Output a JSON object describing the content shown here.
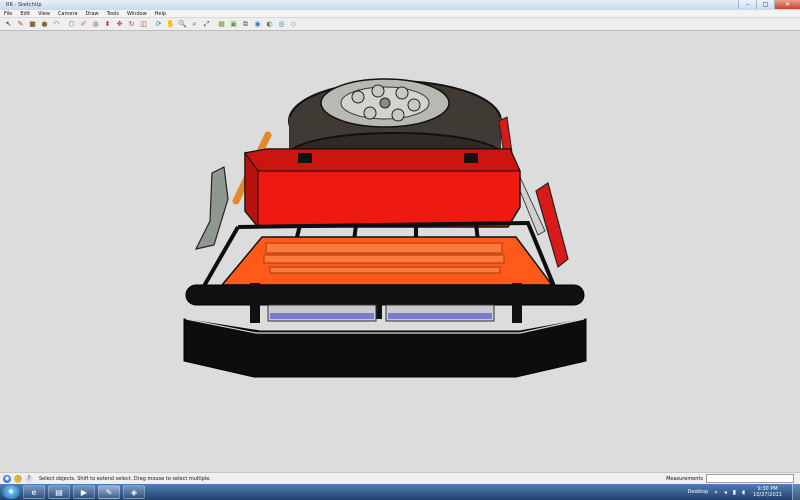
{
  "window": {
    "title": "RR - SketchUp",
    "controls": {
      "minimize": "–",
      "maximize": "□",
      "close": "✕"
    }
  },
  "menu": [
    "File",
    "Edit",
    "View",
    "Camera",
    "Draw",
    "Tools",
    "Window",
    "Help"
  ],
  "toolbar": {
    "tools": [
      {
        "name": "select-tool",
        "glyph": "↖",
        "color": "#222222"
      },
      {
        "name": "pencil-tool",
        "glyph": "✎",
        "color": "#c0392b"
      },
      {
        "name": "rectangle-tool",
        "glyph": "■",
        "color": "#8a6a3b"
      },
      {
        "name": "circle-tool",
        "glyph": "●",
        "color": "#8a6a3b"
      },
      {
        "name": "arc-tool",
        "glyph": "◠",
        "color": "#444444"
      },
      {
        "name": "polygon-tool",
        "glyph": "⬡",
        "color": "#2c7bb6"
      },
      {
        "name": "eraser-tool",
        "glyph": "✐",
        "color": "#d9587a"
      },
      {
        "name": "tape-measure-tool",
        "glyph": "◍",
        "color": "#777777"
      },
      {
        "name": "push-pull-tool",
        "glyph": "⬍",
        "color": "#b03a2e"
      },
      {
        "name": "move-tool",
        "glyph": "✥",
        "color": "#c0392b"
      },
      {
        "name": "rotate-tool",
        "glyph": "↻",
        "color": "#c0392b"
      },
      {
        "name": "offset-tool",
        "glyph": "◫",
        "color": "#b03a2e"
      },
      {
        "name": "orbit-tool",
        "glyph": "⟳",
        "color": "#2c7bb6"
      },
      {
        "name": "pan-tool",
        "glyph": "✋",
        "color": "#444444"
      },
      {
        "name": "zoom-tool",
        "glyph": "🔍",
        "color": "#444444"
      },
      {
        "name": "zoom-window-tool",
        "glyph": "⌕",
        "color": "#444444"
      },
      {
        "name": "zoom-extents-tool",
        "glyph": "⤢",
        "color": "#444444"
      },
      {
        "name": "get-models-tool",
        "glyph": "▦",
        "color": "#6a9a3a"
      },
      {
        "name": "share-model-tool",
        "glyph": "▣",
        "color": "#6a9a3a"
      },
      {
        "name": "components-tool",
        "glyph": "⧉",
        "color": "#555555"
      },
      {
        "name": "google-earth-tool",
        "glyph": "◉",
        "color": "#2c7bb6"
      },
      {
        "name": "place-model-tool",
        "glyph": "◐",
        "color": "#3a8a3a"
      },
      {
        "name": "geo-location-tool",
        "glyph": "◎",
        "color": "#2c7bb6"
      },
      {
        "name": "styles-tool",
        "glyph": "◇",
        "color": "#888888"
      }
    ]
  },
  "status": {
    "hint": "Select objects. Shift to extend select. Drag mouse to select multiple.",
    "measurements_label": "Measurements",
    "measurements_value": ""
  },
  "taskbar": {
    "start_glyph": "❖",
    "apps": [
      {
        "name": "internet-explorer-task",
        "glyph": "e"
      },
      {
        "name": "file-explorer-task",
        "glyph": "▤"
      },
      {
        "name": "media-player-task",
        "glyph": "▶"
      },
      {
        "name": "sketchup-task",
        "glyph": "✎"
      },
      {
        "name": "other-task",
        "glyph": "◈"
      }
    ],
    "tray_label": "Desktop",
    "tray_icons": "» ◂ ▮ ◖",
    "time": "9:30 PM",
    "date": "10/27/2011"
  },
  "colors": {
    "model_red": "#ee1a12",
    "model_orange": "#ff5a1a",
    "bumper_black": "#0d0d0d",
    "tire_dark": "#3f3a33",
    "viewport_bg": "#dcdcdc"
  }
}
